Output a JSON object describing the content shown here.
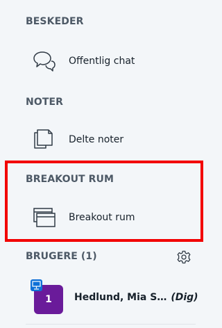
{
  "sections": {
    "messages": {
      "title": "BESKEDER",
      "items": [
        {
          "label": "Offentlig chat",
          "icon": "chat-icon"
        }
      ]
    },
    "notes": {
      "title": "NOTER",
      "items": [
        {
          "label": "Delte noter",
          "icon": "notes-icon"
        }
      ]
    },
    "breakout": {
      "title": "BREAKOUT RUM",
      "items": [
        {
          "label": "Breakout rum",
          "icon": "breakout-rooms-icon"
        }
      ]
    },
    "users": {
      "title": "BRUGERE (1)",
      "list": [
        {
          "avatar_text": "1",
          "name": "Hedlund, Mia S…",
          "role": "(Dig)",
          "avatar_color": "#6a1b9a"
        }
      ]
    }
  },
  "colors": {
    "background": "#f3f6f9",
    "highlight": "#f20000",
    "presenter_badge": "#0f70d7"
  }
}
